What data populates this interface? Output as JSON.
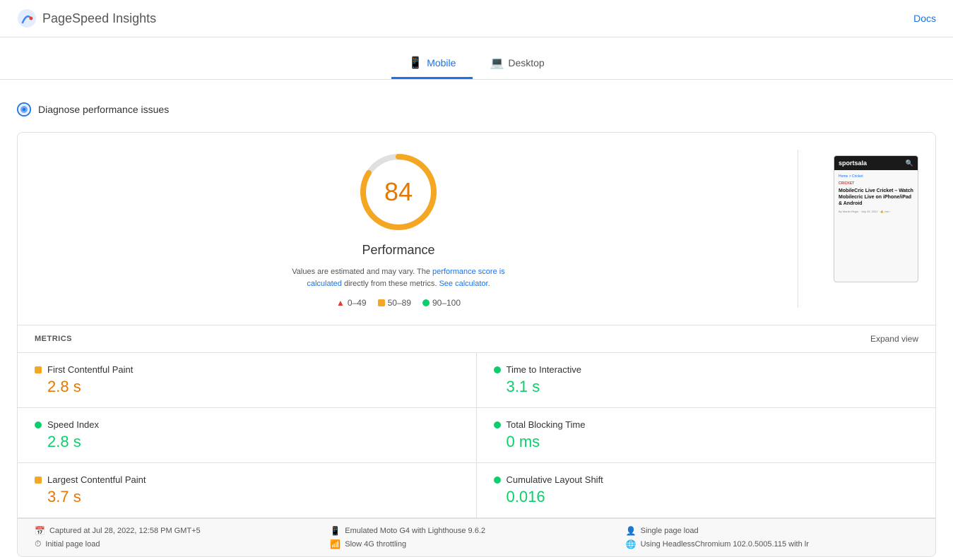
{
  "app": {
    "title": "PageSpeed Insights",
    "docs_label": "Docs"
  },
  "tabs": [
    {
      "id": "mobile",
      "label": "Mobile",
      "icon": "📱",
      "active": true
    },
    {
      "id": "desktop",
      "label": "Desktop",
      "icon": "💻",
      "active": false
    }
  ],
  "diagnose": {
    "label": "Diagnose performance issues"
  },
  "performance": {
    "score": "84",
    "label": "Performance",
    "note_text": "Values are estimated and may vary. The ",
    "note_link1": "performance score is calculated",
    "note_mid": " directly from these metrics. ",
    "note_link2": "See calculator",
    "note_end": ".",
    "legend": [
      {
        "type": "red",
        "range": "0–49"
      },
      {
        "type": "orange",
        "range": "50–89"
      },
      {
        "type": "green",
        "range": "90–100"
      }
    ]
  },
  "screenshot": {
    "site_name": "sportsala",
    "breadcrumb": "Home > Cricket",
    "category": "CRICKET",
    "title": "MobileCric Live Cricket – Watch Mobilecric Live on iPhone/iPad & Android",
    "meta": "By Martin Regis · July 26, 2022 · ✍ min ·",
    "search_icon": "🔍"
  },
  "metrics": {
    "section_label": "METRICS",
    "expand_label": "Expand view",
    "items": [
      {
        "name": "First Contentful Paint",
        "value": "2.8 s",
        "color": "orange",
        "col": 0
      },
      {
        "name": "Time to Interactive",
        "value": "3.1 s",
        "color": "green",
        "col": 1
      },
      {
        "name": "Speed Index",
        "value": "2.8 s",
        "color": "green",
        "col": 0
      },
      {
        "name": "Total Blocking Time",
        "value": "0 ms",
        "color": "green",
        "col": 1
      },
      {
        "name": "Largest Contentful Paint",
        "value": "3.7 s",
        "color": "orange",
        "col": 0
      },
      {
        "name": "Cumulative Layout Shift",
        "value": "0.016",
        "color": "green",
        "col": 1
      }
    ]
  },
  "footer": {
    "items": [
      {
        "icon": "📅",
        "text": "Captured at Jul 28, 2022, 12:58 PM GMT+5"
      },
      {
        "icon": "📱",
        "text": "Emulated Moto G4 with Lighthouse 9.6.2"
      },
      {
        "icon": "👤",
        "text": "Single page load"
      },
      {
        "icon": "⏱",
        "text": "Initial page load"
      },
      {
        "icon": "📶",
        "text": "Slow 4G throttling"
      },
      {
        "icon": "🌐",
        "text": "Using HeadlessChromium 102.0.5005.115 with lr"
      }
    ]
  },
  "colors": {
    "orange": "#e67700",
    "orange_indicator": "#f5a623",
    "green": "#0cce6b",
    "red": "#e53935",
    "blue": "#1a73e8"
  }
}
